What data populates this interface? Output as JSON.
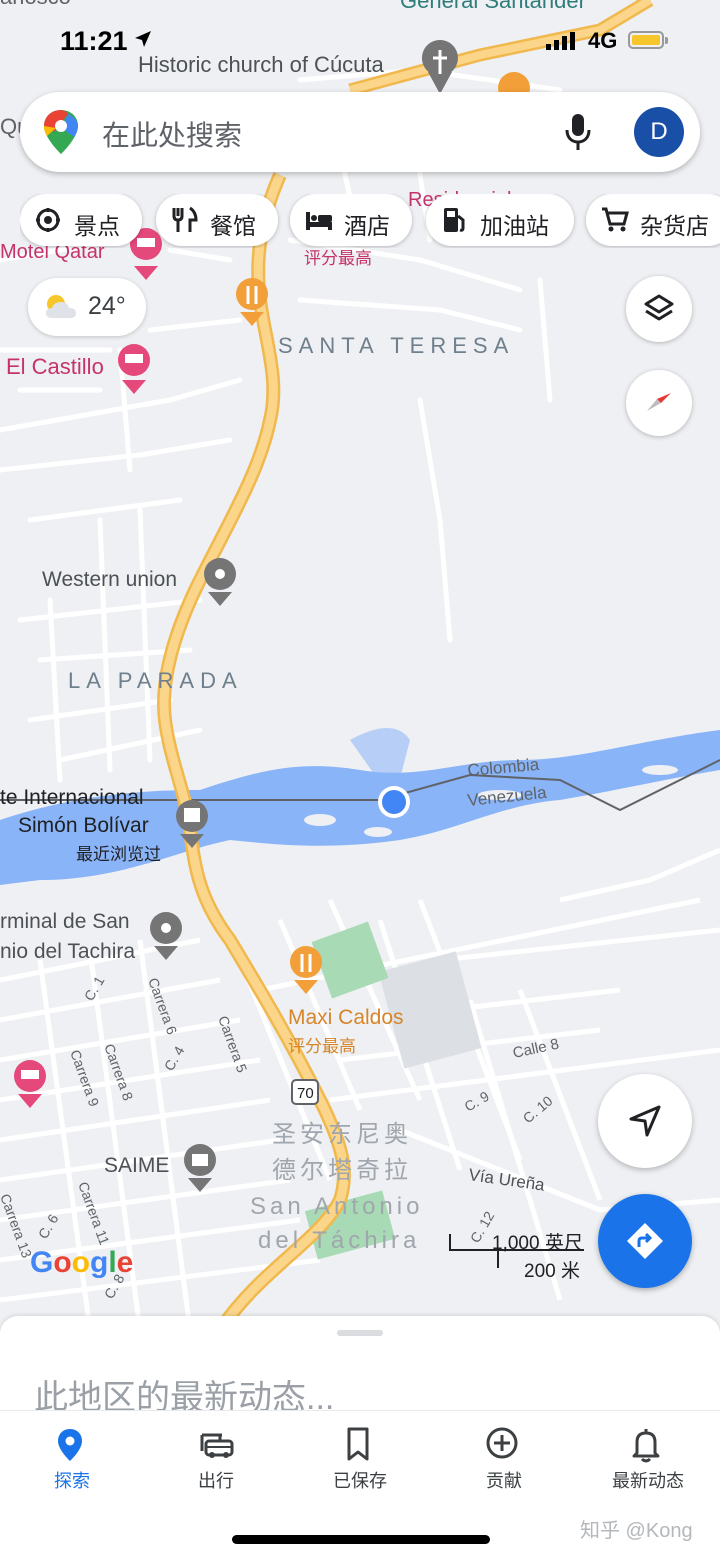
{
  "status": {
    "time": "11:21",
    "network": "4G"
  },
  "search": {
    "placeholder": "在此处搜索",
    "avatar_letter": "D"
  },
  "chips": [
    {
      "label": "景点",
      "icon": "attractions-icon"
    },
    {
      "label": "餐馆",
      "icon": "restaurant-icon"
    },
    {
      "label": "酒店",
      "icon": "hotel-icon"
    },
    {
      "label": "加油站",
      "icon": "gas-station-icon"
    },
    {
      "label": "杂货店",
      "icon": "grocery-cart-icon"
    }
  ],
  "weather": {
    "temp": "24°",
    "icon": "partly-cloudy-icon"
  },
  "map": {
    "top_partial": "ariosco",
    "top_road": "General Santander",
    "church": "Historic church of Cúcuta",
    "partial_qui": "Qui",
    "hotel_residencial": "Residencial",
    "rated_top": "评分最高",
    "motel_qatar": "Motel Qatar",
    "el_castillo": "El Castillo",
    "santa_teresa": "SANTA TERESA",
    "western_union": "Western union",
    "la_parada": "LA PARADA",
    "puente_line1": "te Internacional",
    "puente_line2": "Simón Bolívar",
    "recently_viewed": "最近浏览过",
    "colombia": "Colombia",
    "venezuela": "Venezuela",
    "terminal_line1": "rminal de San",
    "terminal_line2": "nio del Tachira",
    "maxi_caldos": "Maxi Caldos",
    "maxi_rated": "评分最高",
    "saime": "SAIME",
    "san_antonio_zh_1": "圣安东尼奥",
    "san_antonio_zh_2": "德尔塔奇拉",
    "san_antonio_1": "San Antonio",
    "san_antonio_2": "del Táchira",
    "via_urena": "Vía Ureña",
    "calle8": "Calle 8",
    "c1": "C. 1",
    "c4": "C. 4",
    "c6": "C. 6",
    "c8": "C. 8",
    "c9": "C. 9",
    "c10": "C. 10",
    "c12": "C. 12",
    "carrera5": "Carrera 5",
    "carrera6": "Carrera 6",
    "carrera8": "Carrera 8",
    "carrera9": "Carrera 9",
    "carrera11": "Carrera 11",
    "carrera13": "Carrera 13",
    "route70": "70"
  },
  "scale": {
    "imperial": "1,000 英尺",
    "metric": "200 米"
  },
  "google_logo": "Google",
  "sheet": {
    "message": "此地区的最新动态..."
  },
  "nav": [
    {
      "label": "探索",
      "icon": "explore-pin-icon",
      "active": true
    },
    {
      "label": "出行",
      "icon": "car-icon",
      "active": false
    },
    {
      "label": "已保存",
      "icon": "bookmark-icon",
      "active": false
    },
    {
      "label": "贡献",
      "icon": "add-circle-icon",
      "active": false
    },
    {
      "label": "最新动态",
      "icon": "bell-icon",
      "active": false
    }
  ],
  "watermark": "知乎 @Kong",
  "colors": {
    "accent": "#1a73e8",
    "water": "#8ab4f8",
    "road": "#f8c95b",
    "poi_pink": "#e5487a",
    "poi_orange": "#f29f39"
  }
}
